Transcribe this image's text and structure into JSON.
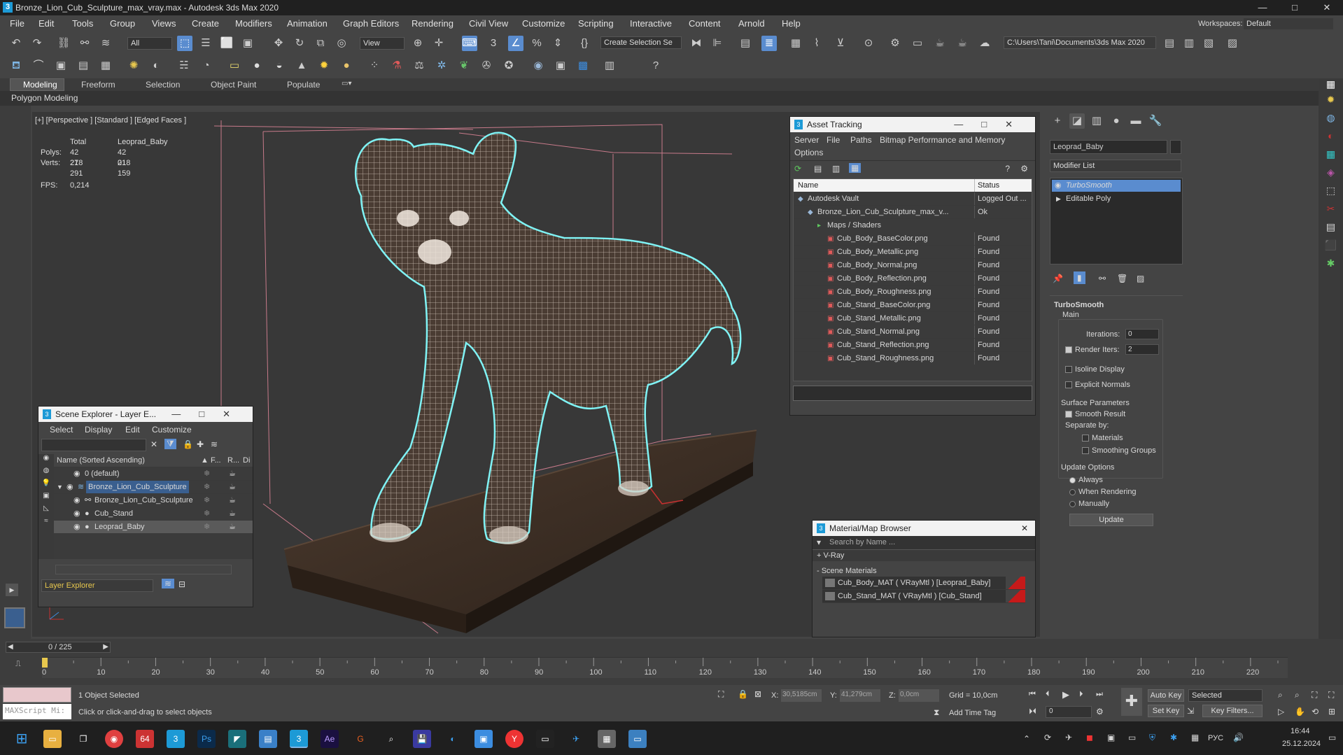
{
  "window": {
    "title": "Bronze_Lion_Cub_Sculpture_max_vray.max - Autodesk 3ds Max 2020",
    "logo": "3",
    "minimize": "—",
    "maximize": "□",
    "close": "✕"
  },
  "menus": [
    "File",
    "Edit",
    "Tools",
    "Group",
    "Views",
    "Create",
    "Modifiers",
    "Animation",
    "Graph Editors",
    "Rendering",
    "Civil View",
    "Customize",
    "Scripting",
    "Interactive",
    "Content",
    "Arnold",
    "Help"
  ],
  "workspace": {
    "label": "Workspaces:",
    "value": "Default"
  },
  "toolbar": {
    "filter": "All",
    "view": "View",
    "selection_set": "Create Selection Se",
    "path": "C:\\Users\\Tani\\Documents\\3ds Max 2020",
    "snap_3": "3",
    "snap_percent": "%"
  },
  "ribbon": {
    "tabs": [
      "Modeling",
      "Freeform",
      "Selection",
      "Object Paint",
      "Populate"
    ],
    "sub": "Polygon Modeling"
  },
  "viewport": {
    "label": "[+] [Perspective ] [Standard ] [Edged Faces ]",
    "stats": {
      "col_total": "Total",
      "col_obj": "Leoprad_Baby",
      "polys_label": "Polys:",
      "polys_total": "42 278",
      "polys_obj": "42 018",
      "verts_label": "Verts:",
      "verts_total": "21 291",
      "verts_obj": "21 159",
      "fps_label": "FPS:",
      "fps": "0,214"
    }
  },
  "asset_tracking": {
    "title": "Asset Tracking",
    "menu": [
      "Server",
      "File",
      "Paths",
      "Bitmap Performance and Memory"
    ],
    "menu2": "Options",
    "col_name": "Name",
    "col_status": "Status",
    "rows": [
      {
        "name": "Autodesk Vault",
        "status": "Logged Out ...",
        "indent": 0
      },
      {
        "name": "Bronze_Lion_Cub_Sculpture_max_v...",
        "status": "Ok",
        "indent": 1
      },
      {
        "name": "Maps / Shaders",
        "status": "",
        "indent": 2
      },
      {
        "name": "Cub_Body_BaseColor.png",
        "status": "Found",
        "indent": 3
      },
      {
        "name": "Cub_Body_Metallic.png",
        "status": "Found",
        "indent": 3
      },
      {
        "name": "Cub_Body_Normal.png",
        "status": "Found",
        "indent": 3
      },
      {
        "name": "Cub_Body_Reflection.png",
        "status": "Found",
        "indent": 3
      },
      {
        "name": "Cub_Body_Roughness.png",
        "status": "Found",
        "indent": 3
      },
      {
        "name": "Cub_Stand_BaseColor.png",
        "status": "Found",
        "indent": 3
      },
      {
        "name": "Cub_Stand_Metallic.png",
        "status": "Found",
        "indent": 3
      },
      {
        "name": "Cub_Stand_Normal.png",
        "status": "Found",
        "indent": 3
      },
      {
        "name": "Cub_Stand_Reflection.png",
        "status": "Found",
        "indent": 3
      },
      {
        "name": "Cub_Stand_Roughness.png",
        "status": "Found",
        "indent": 3
      }
    ]
  },
  "scene_explorer": {
    "title": "Scene Explorer - Layer E...",
    "menu": [
      "Select",
      "Display",
      "Edit",
      "Customize"
    ],
    "col_name": "Name (Sorted Ascending)",
    "col_f": "▲ F...",
    "col_r": "R...",
    "col_d": "Di",
    "rows": [
      {
        "name": "0 (default)",
        "indent": 0,
        "selected": false
      },
      {
        "name": "Bronze_Lion_Cub_Sculpture",
        "indent": 0,
        "selected": false,
        "highlight": true
      },
      {
        "name": "Bronze_Lion_Cub_Sculpture",
        "indent": 1,
        "selected": false
      },
      {
        "name": "Cub_Stand",
        "indent": 1,
        "selected": false
      },
      {
        "name": "Leoprad_Baby",
        "indent": 1,
        "selected": true
      }
    ],
    "footer": "Layer Explorer"
  },
  "material_browser": {
    "title": "Material/Map Browser",
    "search_placeholder": "Search by Name ...",
    "vray": "+ V-Ray",
    "section": "- Scene Materials",
    "items": [
      "Cub_Body_MAT ( VRayMtl ) [Leoprad_Baby]",
      "Cub_Stand_MAT ( VRayMtl ) [Cub_Stand]"
    ]
  },
  "command_panel": {
    "object_name": "Leoprad_Baby",
    "modifier_list": "Modifier List",
    "stack": [
      "TurboSmooth",
      "Editable Poly"
    ],
    "rollout": "TurboSmooth",
    "main": "Main",
    "iterations_label": "Iterations:",
    "iterations": "0",
    "render_iters_label": "Render Iters:",
    "render_iters": "2",
    "isoline": "Isoline Display",
    "explicit": "Explicit Normals",
    "surface": "Surface Parameters",
    "smooth_result": "Smooth Result",
    "separate_by": "Separate by:",
    "materials": "Materials",
    "smoothing_groups": "Smoothing Groups",
    "update_options": "Update Options",
    "always": "Always",
    "when_rendering": "When Rendering",
    "manually": "Manually",
    "update_button": "Update"
  },
  "timeline": {
    "frame": "0 / 225",
    "ticks": [
      "0",
      "10",
      "20",
      "30",
      "40",
      "50",
      "60",
      "70",
      "80",
      "90",
      "100",
      "110",
      "120",
      "130",
      "140",
      "150",
      "160",
      "170",
      "180",
      "190",
      "200",
      "210",
      "220"
    ]
  },
  "status": {
    "maxscript": "MAXScript Mi:",
    "selected": "1 Object Selected",
    "hint": "Click or click-and-drag to select objects",
    "x_label": "X:",
    "x": "30,5185cm",
    "y_label": "Y:",
    "y": "41,279cm",
    "z_label": "Z:",
    "z": "0,0cm",
    "grid": "Grid = 10,0cm",
    "add_time_tag": "Add Time Tag",
    "auto_key": "Auto Key",
    "set_key": "Set Key",
    "key_mode": "Selected",
    "key_filters": "Key Filters...",
    "frame_field": "0"
  },
  "taskbar": {
    "lang": "РУС",
    "time": "16:44",
    "date": "25.12.2024"
  }
}
